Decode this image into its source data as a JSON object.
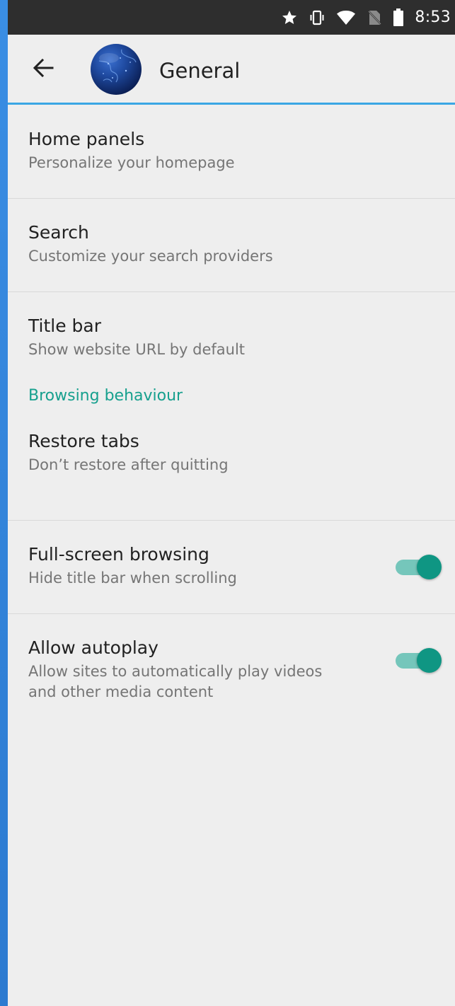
{
  "status_bar": {
    "time": "8:53",
    "icons": [
      "star-icon",
      "vibrate-icon",
      "wifi-icon",
      "no-sim-icon",
      "battery-icon"
    ]
  },
  "toolbar": {
    "back_icon": "arrow-left-icon",
    "logo": "firefox-globe-logo",
    "title": "General"
  },
  "colors": {
    "accent": "#17a08e",
    "toolbar_line": "#3aa6e4",
    "switch_thumb": "#0f9683",
    "switch_track": "#75c6bb"
  },
  "preferences": {
    "home_panels": {
      "title": "Home panels",
      "summary": "Personalize your homepage"
    },
    "search": {
      "title": "Search",
      "summary": "Customize your search providers"
    },
    "title_bar": {
      "title": "Title bar",
      "summary": "Show website URL by default"
    },
    "browsing_category": "Browsing behaviour",
    "restore_tabs": {
      "title": "Restore tabs",
      "summary": "Don’t restore after quitting"
    },
    "full_screen": {
      "title": "Full-screen browsing",
      "summary": "Hide title bar when scrolling",
      "enabled": true
    },
    "autoplay": {
      "title": "Allow autoplay",
      "summary_line1": "Allow sites to automatically play videos",
      "summary_line2": "and other media content",
      "enabled": true
    }
  }
}
